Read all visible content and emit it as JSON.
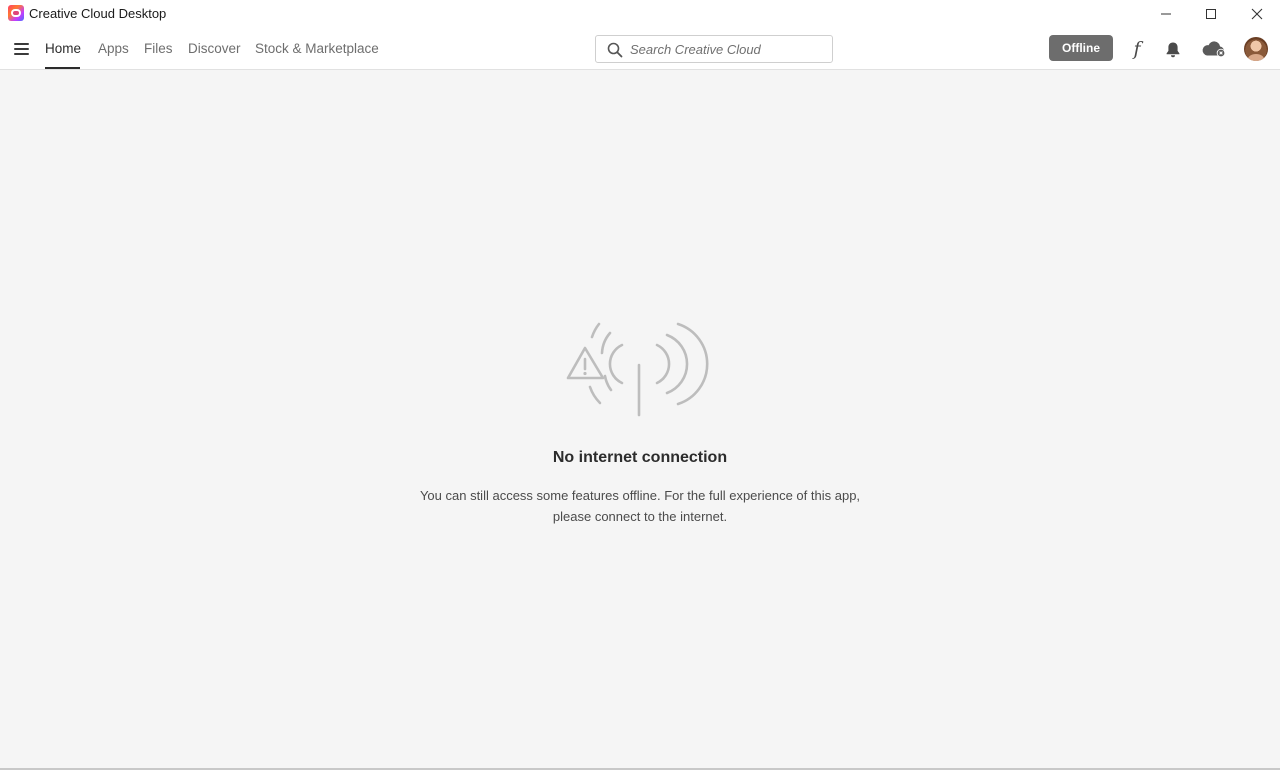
{
  "window": {
    "title": "Creative Cloud Desktop",
    "controls": [
      "minimize",
      "maximize",
      "close"
    ]
  },
  "nav": {
    "menu_icon": "hamburger-menu-icon",
    "tabs": [
      {
        "label": "Home",
        "active": true
      },
      {
        "label": "Apps",
        "active": false
      },
      {
        "label": "Files",
        "active": false
      },
      {
        "label": "Discover",
        "active": false
      },
      {
        "label": "Stock & Marketplace",
        "active": false
      }
    ],
    "search": {
      "placeholder": "Search Creative Cloud",
      "value": ""
    },
    "status_button": "Offline",
    "icons": [
      "fonts-icon",
      "notifications-bell-icon",
      "cloud-sync-error-icon",
      "user-avatar"
    ]
  },
  "main": {
    "illustration": "no-signal-warning-icon",
    "title": "No internet connection",
    "message": "You can still access some features offline. For the full experience of this app, please connect to the internet."
  },
  "colors": {
    "accent_text": "#2c2c2c",
    "offline_button": "#6d6d6d",
    "background": "#f5f5f5"
  }
}
